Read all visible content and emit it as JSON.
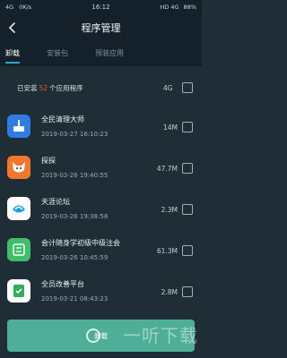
{
  "status_bar": {
    "signal": "4G",
    "speed": "0K/s",
    "time": "16:12",
    "network": "HD 4G",
    "battery": "88%"
  },
  "header": {
    "title": "程序管理"
  },
  "tabs": [
    {
      "label": "卸载",
      "active": true
    },
    {
      "label": "安装包",
      "active": false
    },
    {
      "label": "预装应用",
      "active": false
    }
  ],
  "summary": {
    "prefix": "已安装",
    "count": "52",
    "suffix": "个应用程序",
    "total_size": "4G"
  },
  "apps": [
    {
      "name": "全民清理大师",
      "date": "2019-03-27 16:10:23",
      "size": "14M",
      "icon": "broom-icon",
      "color": "#2f7de1"
    },
    {
      "name": "探探",
      "date": "2019-03-26 19:40:55",
      "size": "47.7M",
      "icon": "fox-icon",
      "color": "#f0782c"
    },
    {
      "name": "天涯论坛",
      "date": "2019-03-26 19:38:58",
      "size": "2.3M",
      "icon": "tianya-icon",
      "color": "#1a9fe0"
    },
    {
      "name": "会计随身学初级中级注会",
      "date": "2019-03-26 10:45:59",
      "size": "61.3M",
      "icon": "accounting-icon",
      "color": "#3fbf6a"
    },
    {
      "name": "全员改善平台",
      "date": "2019-03-21 08:43:23",
      "size": "2.8M",
      "icon": "platform-icon",
      "color": "#ffffff"
    }
  ],
  "footer": {
    "uninstall_label": "卸载",
    "watermark": "一听下载"
  }
}
